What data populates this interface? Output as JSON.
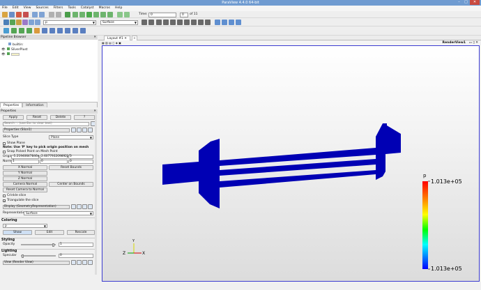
{
  "window": {
    "title": "ParaView 4.4.0 64-bit",
    "controls": [
      "–",
      "□",
      "✕"
    ]
  },
  "menu": [
    "File",
    "Edit",
    "View",
    "Sources",
    "Filters",
    "Tools",
    "Catalyst",
    "Macros",
    "Help"
  ],
  "toolbar": {
    "time_label": "Time:",
    "time_value": "0",
    "step_value": "0",
    "of_label": "of 11",
    "array_combo": "p",
    "representation_combo": "Surface"
  },
  "pipeline": {
    "title": "Pipeline Browser",
    "items": [
      "builtin:",
      "SliverPlust",
      ""
    ]
  },
  "tabs": {
    "properties": "Properties",
    "information": "Information"
  },
  "properties": {
    "title": "Properties",
    "apply": "Apply",
    "reset": "Reset",
    "delete": "Delete",
    "help": "?",
    "search_placeholder": "Search ... (use Esc to clear text)",
    "section_props": "Properties (Slice1)",
    "slice_type_label": "Slice Type",
    "slice_type_value": "Plane",
    "show_plane": "Show Plane",
    "note": "Note: Use 'P' key to pick origin position on mesh",
    "snap_mesh": "Snap Picked Point on Mesh Point",
    "origin_label": "Origin",
    "origin_x": "-5.21940647846e",
    "origin_y": "2.60779320989223e",
    "origin_z": "0",
    "normal_label": "Normal",
    "normal_x": "1",
    "normal_y": "0",
    "normal_z": "0",
    "x_normal": "X Normal",
    "y_normal": "Y Normal",
    "z_normal": "Z Normal",
    "reset_bounds": "Reset Bounds",
    "camera_normal": "Camera Normal",
    "center_on_bounds": "Center on Bounds",
    "reset_camera_normal": "Reset Camera to Normal",
    "crinkle": "Crinkle slice",
    "triangulate": "Triangulate the slice",
    "section_display": "Display (GeometryRepresentation)",
    "representation_label": "Representation",
    "representation_value": "Surface",
    "coloring": "Coloring",
    "coloring_value": "p",
    "show": "Show",
    "edit": "Edit",
    "rescale": "Rescale",
    "styling": "Styling",
    "opacity_label": "Opacity",
    "opacity_value": "1",
    "opacity_fraction": 1.0,
    "lighting": "Lighting",
    "specular_label": "Specular",
    "specular_value": "0",
    "specular_fraction": 0.0,
    "section_view": "View (Render View)"
  },
  "view": {
    "tab_label": "Layout #1",
    "render_label": "RenderView1"
  },
  "colorbar": {
    "title": "p",
    "max": "1.013e+05",
    "min": "1.013e+05"
  },
  "axes": {
    "x": "X",
    "y": "Y",
    "z": "Z"
  },
  "colors": {
    "accent": "#3b3bd0",
    "mesh": "#0000b4",
    "titlebar": "#6f9bd1"
  }
}
